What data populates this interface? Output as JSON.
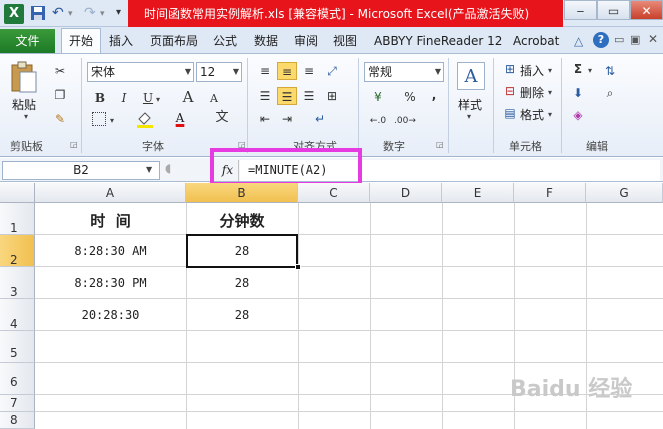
{
  "window": {
    "title": "时间函数常用实例解析.xls  [兼容模式] - Microsoft Excel(产品激活失败)",
    "title_band_color": "#e8141b",
    "controls": {
      "minimize": "‒",
      "restore": "▭",
      "close": "✕"
    }
  },
  "quick_access": [
    "excel-logo-icon",
    "save-icon",
    "undo-icon",
    "redo-icon",
    "customize-icon"
  ],
  "tabs": [
    "文件",
    "开始",
    "插入",
    "页面布局",
    "公式",
    "数据",
    "审阅",
    "视图",
    "ABBYY FineReader 12",
    "Acrobat"
  ],
  "active_tab": "开始",
  "ribbon": {
    "clipboard": {
      "label": "剪贴板",
      "paste": "粘贴"
    },
    "font": {
      "label": "字体",
      "font_name": "宋体",
      "font_size": "12",
      "bold": "B",
      "italic": "I",
      "underline": "U",
      "grow": "A",
      "shrink": "A",
      "font_color_glyph": "A",
      "phonetic": "文"
    },
    "alignment": {
      "label": "对齐方式"
    },
    "number": {
      "label": "数字",
      "format": "常规",
      "percent": "%",
      "comma": ","
    },
    "styles": {
      "label": "样式"
    },
    "cells": {
      "label": "单元格",
      "insert": "插入",
      "delete": "删除",
      "format": "格式"
    },
    "editing": {
      "label": "编辑",
      "sum": "Σ"
    }
  },
  "formula_bar": {
    "name_box": "B2",
    "fx": "fx",
    "formula": "=MINUTE(A2)"
  },
  "sheet": {
    "columns": [
      "A",
      "B",
      "C",
      "D",
      "E",
      "F",
      "G"
    ],
    "rows": [
      "1",
      "2",
      "3",
      "4",
      "5",
      "6",
      "7",
      "8"
    ],
    "a1": "时  间",
    "b1": "分钟数",
    "a2": "8:28:30 AM",
    "b2": "28",
    "a3": "8:28:30 PM",
    "b3": "28",
    "a4": "20:28:30",
    "b4": "28",
    "selected_cell": "B2"
  },
  "highlight_color": "#e63be0",
  "watermark": "Baidu 经验"
}
